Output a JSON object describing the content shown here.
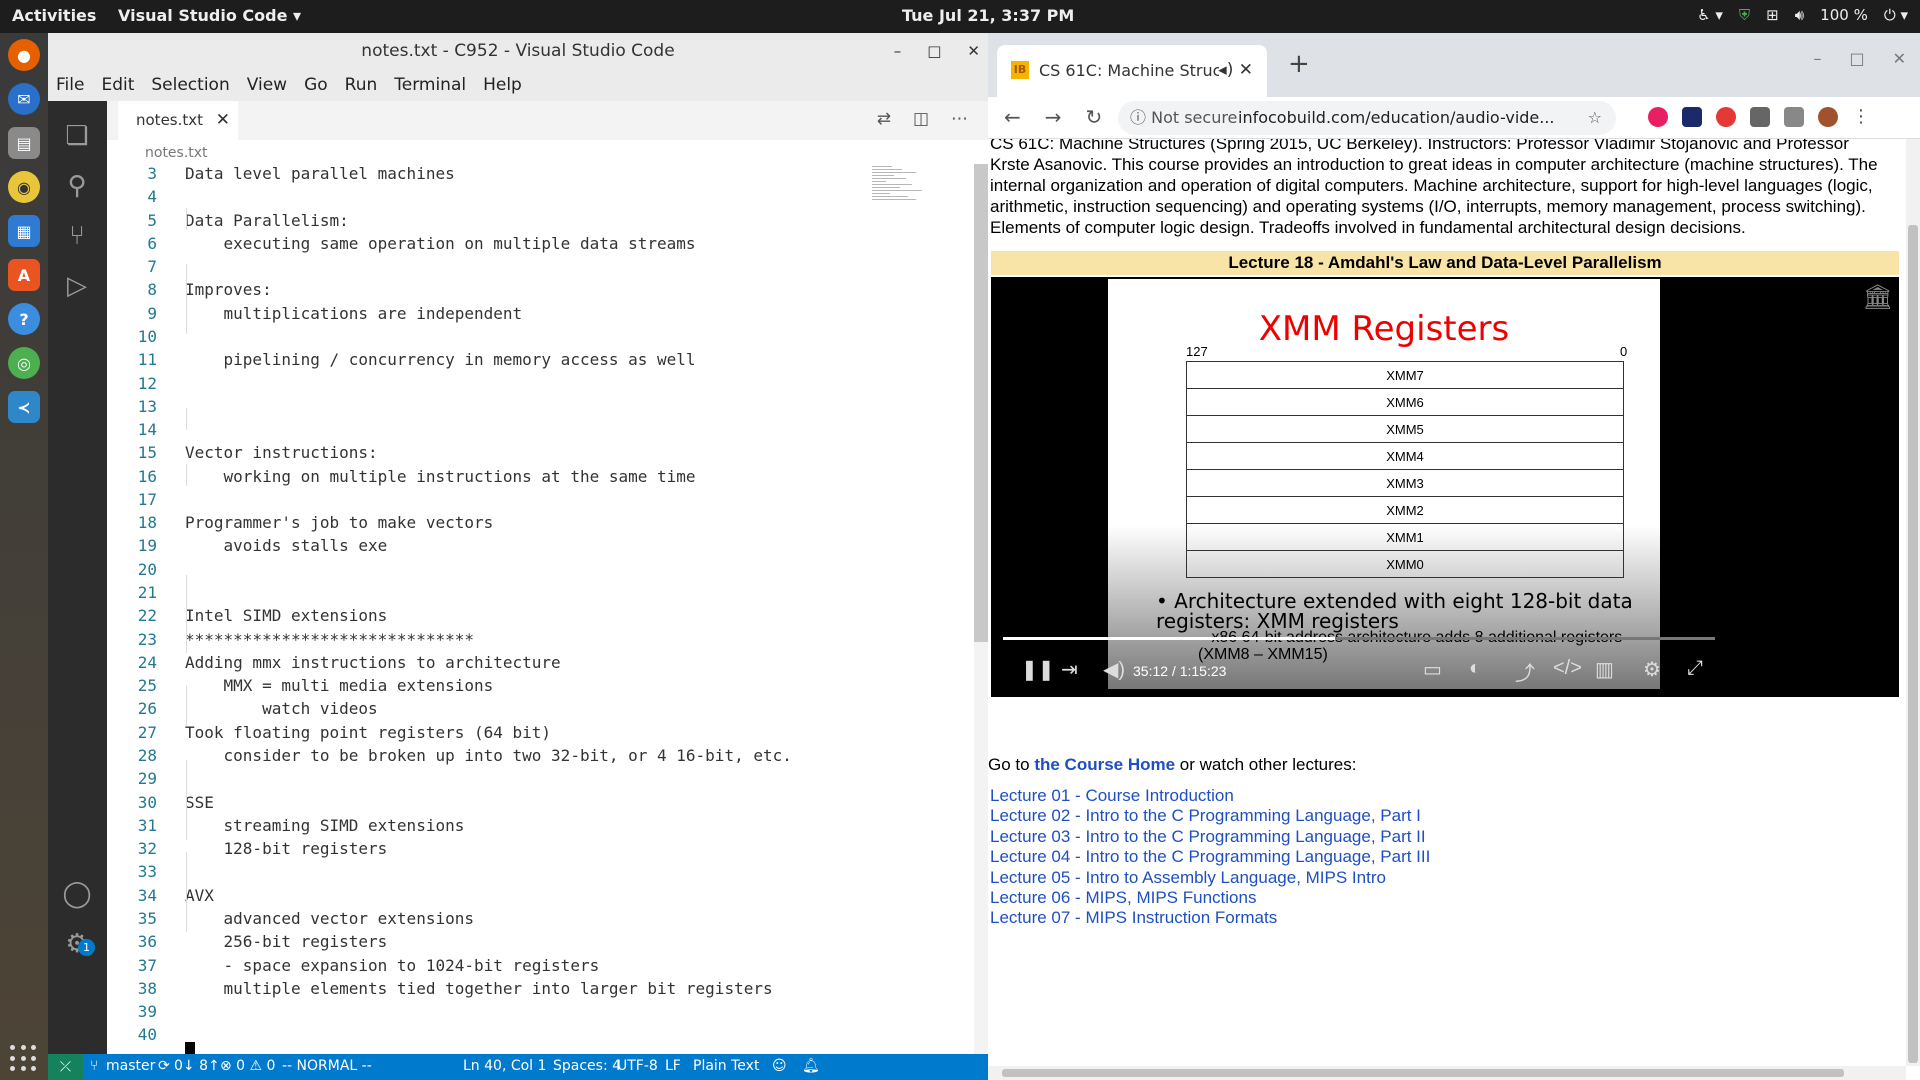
{
  "topbar": {
    "activities": "Activities",
    "app_name": "Visual Studio Code ▾",
    "clock": "Tue Jul 21,  3:37 PM",
    "battery": "100 %"
  },
  "vscode": {
    "window_title": "notes.txt - C952 - Visual Studio Code",
    "menu": [
      "File",
      "Edit",
      "Selection",
      "View",
      "Go",
      "Run",
      "Terminal",
      "Help"
    ],
    "tab_label": "notes.txt",
    "breadcrumb": "notes.txt",
    "lines": [
      {
        "n": "3",
        "t": "Data level parallel machines"
      },
      {
        "n": "4",
        "t": ""
      },
      {
        "n": "5",
        "t": "Data Parallelism:"
      },
      {
        "n": "6",
        "t": "    executing same operation on multiple data streams"
      },
      {
        "n": "7",
        "t": ""
      },
      {
        "n": "8",
        "t": "Improves:"
      },
      {
        "n": "9",
        "t": "    multiplications are independent"
      },
      {
        "n": "10",
        "t": ""
      },
      {
        "n": "11",
        "t": "    pipelining / concurrency in memory access as well"
      },
      {
        "n": "12",
        "t": ""
      },
      {
        "n": "13",
        "t": ""
      },
      {
        "n": "14",
        "t": ""
      },
      {
        "n": "15",
        "t": "Vector instructions:"
      },
      {
        "n": "16",
        "t": "    working on multiple instructions at the same time"
      },
      {
        "n": "17",
        "t": ""
      },
      {
        "n": "18",
        "t": "Programmer's job to make vectors"
      },
      {
        "n": "19",
        "t": "    avoids stalls exe"
      },
      {
        "n": "20",
        "t": ""
      },
      {
        "n": "21",
        "t": ""
      },
      {
        "n": "22",
        "t": "Intel SIMD extensions"
      },
      {
        "n": "23",
        "t": "******************************"
      },
      {
        "n": "24",
        "t": "Adding mmx instructions to architecture"
      },
      {
        "n": "25",
        "t": "    MMX = multi media extensions"
      },
      {
        "n": "26",
        "t": "        watch videos"
      },
      {
        "n": "27",
        "t": "Took floating point registers (64 bit)"
      },
      {
        "n": "28",
        "t": "    consider to be broken up into two 32-bit, or 4 16-bit, etc."
      },
      {
        "n": "29",
        "t": ""
      },
      {
        "n": "30",
        "t": "SSE"
      },
      {
        "n": "31",
        "t": "    streaming SIMD extensions"
      },
      {
        "n": "32",
        "t": "    128-bit registers"
      },
      {
        "n": "33",
        "t": ""
      },
      {
        "n": "34",
        "t": "AVX"
      },
      {
        "n": "35",
        "t": "    advanced vector extensions"
      },
      {
        "n": "36",
        "t": "    256-bit registers"
      },
      {
        "n": "37",
        "t": "    - space expansion to 1024-bit registers"
      },
      {
        "n": "38",
        "t": "    multiple elements tied together into larger bit registers"
      },
      {
        "n": "39",
        "t": ""
      },
      {
        "n": "40",
        "t": ""
      }
    ],
    "status": {
      "branch": "master",
      "sync": "0↓ 8↑",
      "problems": "⊗ 0 ⚠ 0",
      "mode": "-- NORMAL --",
      "position": "Ln 40, Col 1",
      "spaces": "Spaces: 4",
      "encoding": "UTF-8",
      "eol": "LF",
      "language": "Plain Text"
    },
    "settings_badge": "1"
  },
  "chrome": {
    "tab_title": "CS 61C: Machine Struc",
    "url_security": "Not secure",
    "url": "infocobuild.com/education/audio-vide...",
    "description": "CS 61C: Machine Structures (Spring 2015, UC Berkeley). Instructors: Professor Vladimir Stojanovic and Professor Krste Asanovic. This course provides an introduction to great ideas in computer architecture (machine structures). The internal organization and operation of digital computers. Machine architecture, support for high-level languages (logic, arithmetic, instruction sequencing) and operating systems (I/O, interrupts, memory management, process switching). Elements of computer logic design. Tradeoffs involved in fundamental architectural design decisions.",
    "lecture_heading": "Lecture 18 - Amdahl's Law and Data-Level Parallelism",
    "slide": {
      "title": "XMM Registers",
      "bit_high": "127",
      "bit_low": "0",
      "registers": [
        "XMM7",
        "XMM6",
        "XMM5",
        "XMM4",
        "XMM3",
        "XMM2",
        "XMM1",
        "XMM0"
      ],
      "bullet": "Architecture extended with eight 128-bit data registers: XMM registers",
      "sub_bullet": "– x86 64-bit address architecture adds 8 additional registers (XMM8 – XMM15)"
    },
    "video": {
      "time": "35:12  /  1:15:23",
      "progress": 0.466
    },
    "goto_prefix": "Go to ",
    "goto_link": "the Course Home",
    "goto_suffix": " or watch other lectures:",
    "lectures": [
      "Lecture 01 - Course Introduction",
      "Lecture 02 - Intro to the C Programming Language, Part I",
      "Lecture 03 - Intro to the C Programming Language, Part II",
      "Lecture 04 - Intro to the C Programming Language, Part III",
      "Lecture 05 - Intro to Assembly Language, MIPS Intro",
      "Lecture 06 - MIPS, MIPS Functions",
      "Lecture 07 - MIPS Instruction Formats"
    ]
  }
}
